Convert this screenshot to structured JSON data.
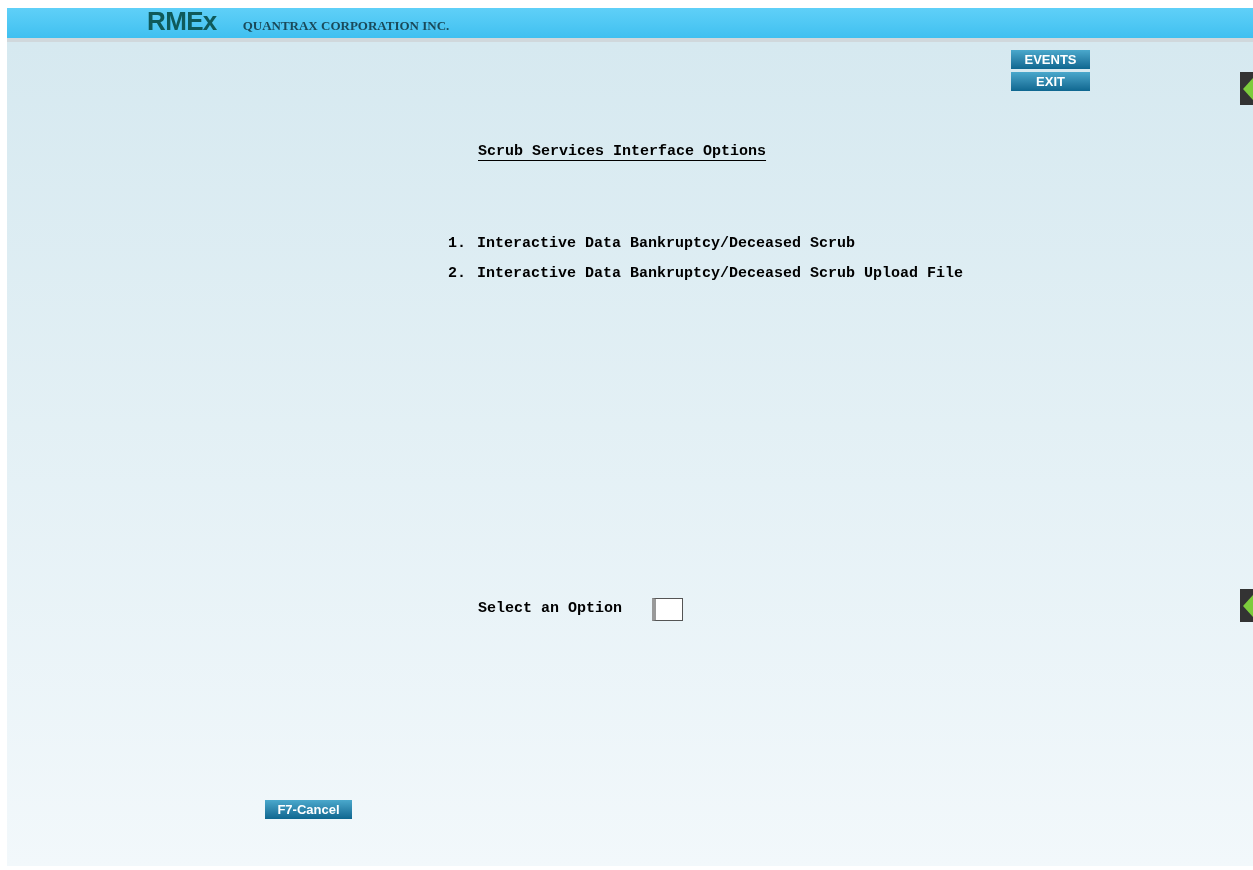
{
  "header": {
    "logo": "RMEx",
    "company": "QUANTRAX CORPORATION INC."
  },
  "buttons": [
    {
      "label": "EVENTS"
    },
    {
      "label": "EXIT"
    }
  ],
  "title": "Scrub Services Interface Options",
  "options": [
    {
      "number": "1.",
      "label": "Interactive Data Bankruptcy/Deceased Scrub"
    },
    {
      "number": "2.",
      "label": "Interactive Data Bankruptcy/Deceased Scrub Upload File"
    }
  ],
  "prompt": {
    "label": "Select an Option"
  },
  "cancel_button": "F7-Cancel"
}
